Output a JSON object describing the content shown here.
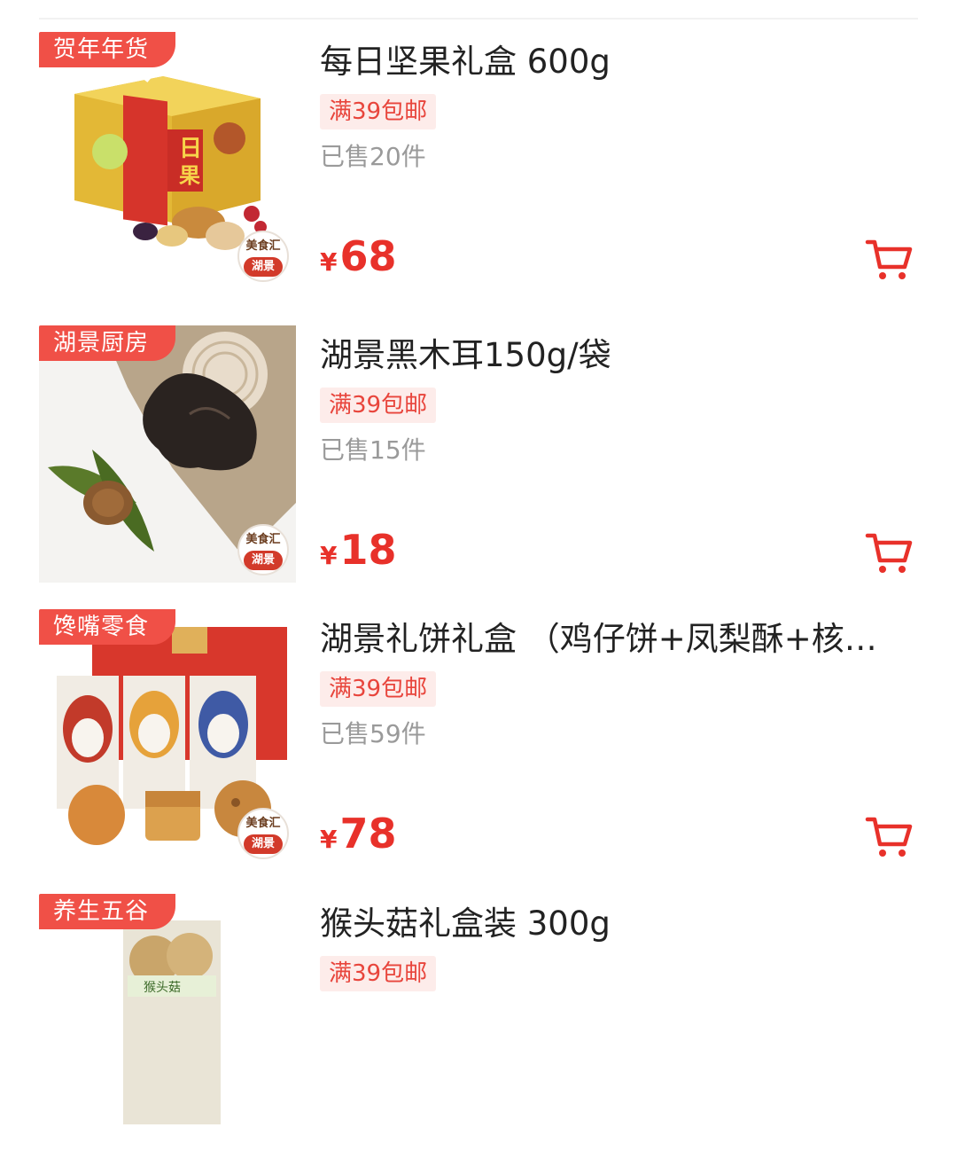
{
  "colors": {
    "accent": "#e8312a",
    "tag_bg": "#f05047",
    "promo_bg": "#fdecea",
    "sold_text": "#9a9a9a"
  },
  "brand_badge": {
    "top_text": "美食汇",
    "bottom_text": "湖景"
  },
  "products": [
    {
      "tag": "贺年年货",
      "title": "每日坚果礼盒 600g",
      "promo": "满39包邮",
      "sold": "已售20件",
      "currency": "¥",
      "price": "68",
      "image_icon": "nut-gift-box-image",
      "cart_icon": "shopping-cart-icon"
    },
    {
      "tag": "湖景厨房",
      "title": "湖景黑木耳150g/袋",
      "promo": "满39包邮",
      "sold": "已售15件",
      "currency": "¥",
      "price": "18",
      "image_icon": "black-fungus-image",
      "cart_icon": "shopping-cart-icon"
    },
    {
      "tag": "馋嘴零食",
      "title": "湖景礼饼礼盒 （鸡仔饼+凤梨酥+核…",
      "promo": "满39包邮",
      "sold": "已售59件",
      "currency": "¥",
      "price": "78",
      "image_icon": "pastry-gift-box-image",
      "cart_icon": "shopping-cart-icon"
    },
    {
      "tag": "养生五谷",
      "title": "猴头菇礼盒装 300g",
      "promo": "满39包邮",
      "sold": "",
      "currency": "¥",
      "price": "",
      "image_icon": "mushroom-box-image",
      "image_label": "猴头菇",
      "cart_icon": "shopping-cart-icon"
    }
  ]
}
